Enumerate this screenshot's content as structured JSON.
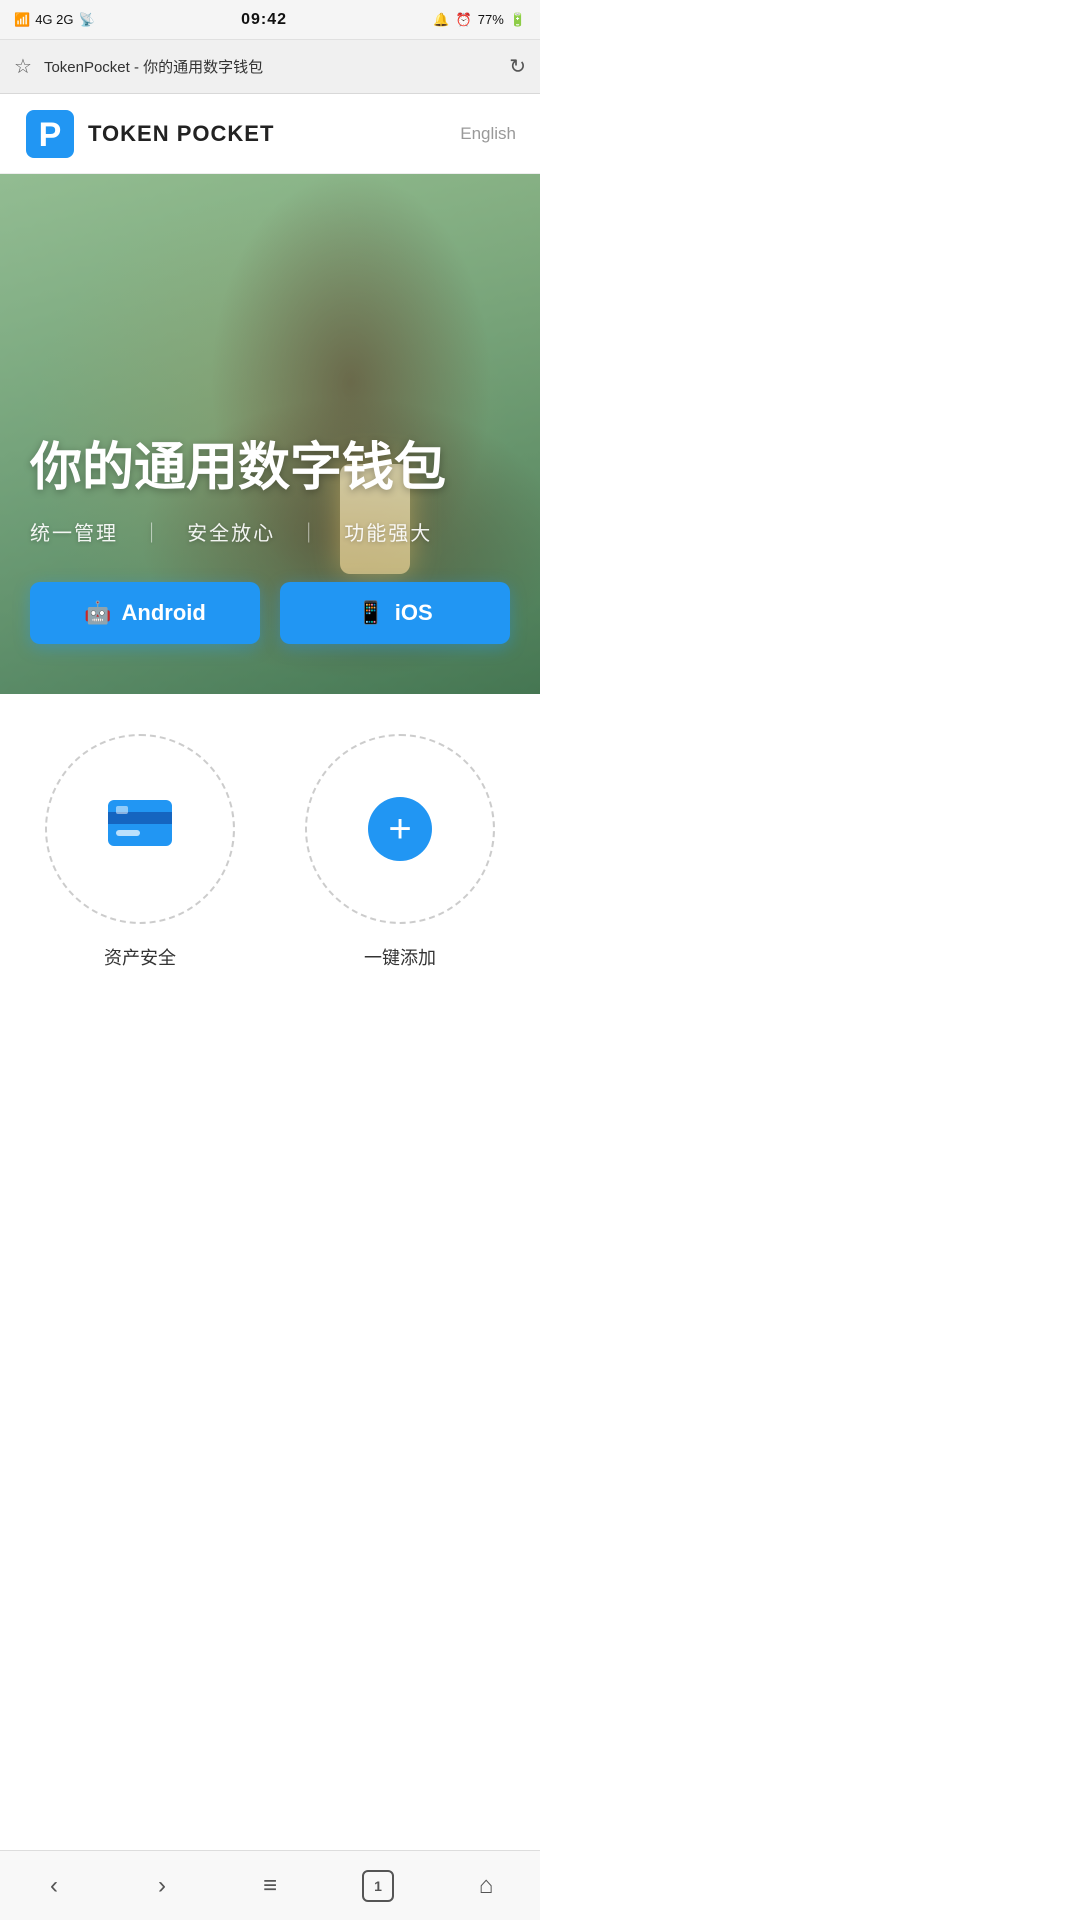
{
  "statusBar": {
    "signal": "4G 2G",
    "wifi": "WiFi",
    "time": "09:42",
    "battery": "77%",
    "icons": [
      "bell-icon",
      "alarm-icon",
      "call-hd-icon"
    ]
  },
  "browserBar": {
    "title": "TokenPocket - 你的通用数字钱包",
    "star_icon": "☆",
    "refresh_icon": "↻"
  },
  "header": {
    "logo_text": "TOKEN POCKET",
    "lang_label": "English"
  },
  "hero": {
    "title": "你的通用数字钱包",
    "subtitle_parts": [
      "统一管理",
      "安全放心",
      "功能强大"
    ],
    "android_label": "Android",
    "ios_label": "iOS"
  },
  "features": [
    {
      "icon_type": "card",
      "label": "资产安全"
    },
    {
      "icon_type": "plus",
      "label": "一键添加"
    }
  ],
  "bottomNav": {
    "back": "‹",
    "forward": "›",
    "menu": "≡",
    "tabs": "1",
    "home": "⌂"
  }
}
